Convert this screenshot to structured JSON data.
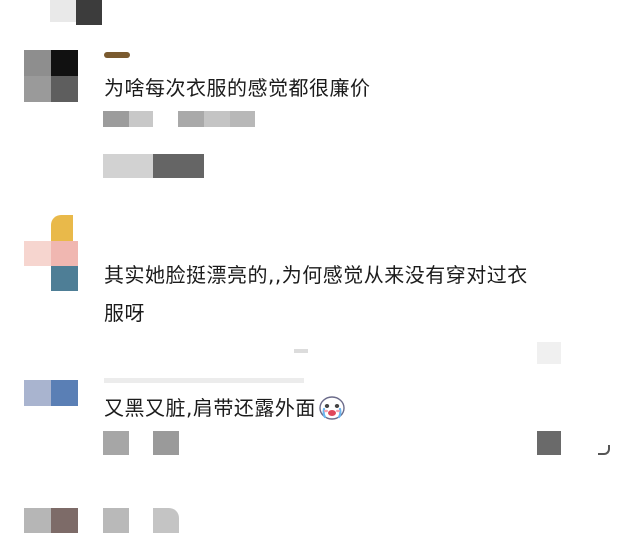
{
  "comments": [
    {
      "text": "为啥每次衣服的感觉都很廉价"
    },
    {
      "text_line1": "其实她脸挺漂亮的,,为何感觉从来没有穿对过衣",
      "text_line2": "服呀"
    },
    {
      "text": "又黑又脏,肩带还露外面",
      "emoji": "crying-face-icon"
    }
  ],
  "colors": {
    "background": "#ffffff",
    "text": "#1b1b1b",
    "blur_gray_dark": "#4a4a4a",
    "blur_gray_mid": "#8a8a8a",
    "blur_gray_light": "#cfcfcf",
    "avatar_yellow": "#e9b94a",
    "avatar_pink": "#f2c4c0",
    "avatar_teal": "#4e7e96",
    "avatar_blue": "#5a7fb5"
  }
}
